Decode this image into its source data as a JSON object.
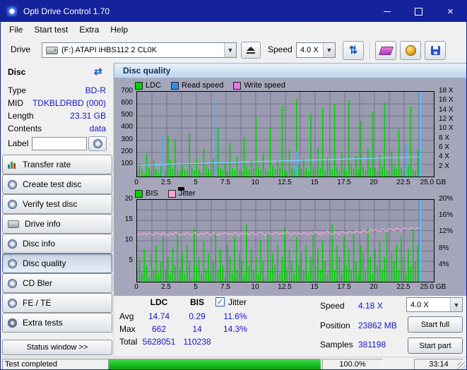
{
  "window": {
    "title": "Opti Drive Control 1.70"
  },
  "menu": {
    "items": [
      "File",
      "Start test",
      "Extra",
      "Help"
    ]
  },
  "toolbar": {
    "drive_label": "Drive",
    "drive_value": "(F:)  ATAPI iHBS112  2 CL0K",
    "speed_label": "Speed",
    "speed_value": "4.0 X"
  },
  "sidebar": {
    "disc_header": "Disc",
    "info": [
      {
        "label": "Type",
        "value": "BD-R"
      },
      {
        "label": "MID",
        "value": "TDKBLDRBD (000)"
      },
      {
        "label": "Length",
        "value": "23.31 GB"
      },
      {
        "label": "Contents",
        "value": "data"
      }
    ],
    "label_label": "Label",
    "label_value": "",
    "buttons": [
      "Transfer rate",
      "Create test disc",
      "Verify test disc",
      "Drive info",
      "Disc info",
      "Disc quality",
      "CD Bler",
      "FE / TE",
      "Extra tests"
    ],
    "active_button": "Disc quality",
    "status_window": "Status window >>"
  },
  "panel": {
    "title": "Disc quality"
  },
  "stats": {
    "headers": {
      "ldc": "LDC",
      "bis": "BIS"
    },
    "jitter_checkbox_label": "Jitter",
    "jitter_checked": true,
    "rows": [
      {
        "label": "Avg",
        "ldc": "14.74",
        "bis": "0.29",
        "jitter": "11.6%"
      },
      {
        "label": "Max",
        "ldc": "662",
        "bis": "14",
        "jitter": "14.3%"
      },
      {
        "label": "Total",
        "ldc": "5628051",
        "bis": "110238",
        "jitter": ""
      }
    ],
    "right": [
      {
        "label": "Speed",
        "value": "4.18 X"
      },
      {
        "label": "Position",
        "value": "23862 MB"
      },
      {
        "label": "Samples",
        "value": "381198"
      }
    ],
    "speed_select": "4.0 X",
    "start_full": "Start full",
    "start_part": "Start part"
  },
  "statusbar": {
    "status": "Test completed",
    "percent": "100.0%",
    "time": "33:14"
  },
  "colors": {
    "titlebar": "#14229b",
    "ldc_bar": "#00d400",
    "read_speed": "#2f8fe8",
    "write_speed": "#e878e0",
    "bis_bar": "#00d400",
    "jitter_line": "#f8a8d0",
    "value_text": "#1414cc",
    "progress": "#00b400",
    "chart_bg": "#9a9ab1"
  },
  "chart_data": [
    {
      "type": "bar",
      "title": "Disc quality - LDC / Read speed",
      "x_max_gb": 25.0,
      "data_end_gb": 23.86,
      "position_marker_gb": 23.86,
      "axis_marker_gb": 3.5,
      "x_ticks": [
        "0",
        "2.5",
        "5",
        "7.5",
        "10",
        "12.5",
        "15",
        "17.5",
        "20",
        "22.5",
        "25.0 GB"
      ],
      "y_left_ticks": [
        "700",
        "600",
        "500",
        "400",
        "300",
        "200",
        "100"
      ],
      "y_left_max": 700,
      "y_right_ticks": [
        "18 X",
        "16 X",
        "14 X",
        "12 X",
        "10 X",
        "8 X",
        "6 X",
        "4 X",
        "2 X"
      ],
      "y_right_max": 18,
      "series": [
        {
          "name": "LDC",
          "type": "bar",
          "color": "#00d400",
          "values": [
            38,
            110,
            55,
            25,
            185,
            70,
            45,
            130,
            60,
            30,
            85,
            240,
            50,
            340,
            140,
            65,
            310,
            55,
            40,
            100,
            60,
            45,
            360,
            80,
            50,
            160,
            55,
            35,
            230,
            90,
            65,
            40,
            150,
            50,
            400,
            75,
            55,
            120,
            45,
            280,
            70,
            50,
            170,
            60,
            40,
            330,
            85,
            55,
            130,
            65,
            490,
            80,
            50,
            190,
            70,
            45,
            410,
            90,
            60,
            140,
            75,
            580,
            55,
            40,
            220,
            80,
            50,
            640,
            95,
            65,
            150,
            70,
            45,
            520,
            85,
            55,
            240,
            75,
            570,
            50,
            160,
            90,
            60,
            600,
            80,
            50,
            200,
            70,
            45,
            630,
            95,
            65,
            170,
            55,
            460,
            85,
            50,
            230,
            75,
            540,
            70,
            45,
            180,
            80,
            610,
            55,
            40,
            210,
            90,
            65,
            390,
            75,
            50,
            250,
            85,
            580,
            60,
            45,
            220,
            80
          ]
        },
        {
          "name": "Read speed",
          "type": "line",
          "color": "#2f8fe8",
          "speed_start": 2.42,
          "speed_end": 4.18
        },
        {
          "name": "Write speed",
          "type": "line",
          "color": "#e878e0",
          "values": []
        }
      ],
      "read_spikes": [
        {
          "i": 11,
          "v": 340
        },
        {
          "i": 33,
          "v": 630
        },
        {
          "i": 67,
          "v": 210
        },
        {
          "i": 113,
          "v": 260
        }
      ]
    },
    {
      "type": "bar",
      "title": "Disc quality - BIS / Jitter",
      "x_max_gb": 25.0,
      "data_end_gb": 23.86,
      "position_marker_gb": 23.86,
      "x_ticks": [
        "0",
        "2.5",
        "5",
        "7.5",
        "10",
        "12.5",
        "15",
        "17.5",
        "20",
        "22.5",
        "25.0 GB"
      ],
      "y_left_ticks": [
        "20",
        "15",
        "10",
        "5"
      ],
      "y_left_max": 20,
      "y_right_ticks": [
        "20%",
        "16%",
        "12%",
        "8%",
        "4%"
      ],
      "y_right_max": 20,
      "series": [
        {
          "name": "BIS",
          "type": "bar",
          "color": "#00d400",
          "values": [
            3,
            6,
            2,
            8,
            4,
            1,
            7,
            3,
            9,
            2,
            5,
            11,
            3,
            6,
            2,
            8,
            4,
            12,
            3,
            7,
            2,
            9,
            5,
            1,
            13,
            4,
            6,
            2,
            10,
            3,
            7,
            2,
            5,
            12,
            3,
            8,
            4,
            1,
            9,
            6,
            2,
            11,
            3,
            7,
            5,
            2,
            14,
            4,
            8,
            3,
            6,
            2,
            10,
            5,
            1,
            12,
            3,
            7,
            4,
            9,
            2,
            6,
            13,
            3,
            8,
            5,
            2,
            11,
            4,
            7,
            3,
            9,
            2,
            6,
            12,
            4,
            8,
            3,
            10,
            5,
            2,
            7,
            14,
            3,
            9,
            6,
            2,
            11,
            4,
            8,
            3,
            12,
            5,
            2,
            9,
            7,
            3,
            13,
            6,
            2,
            8,
            4,
            10,
            3,
            6,
            12,
            2,
            7,
            5,
            9,
            3,
            11,
            6,
            2,
            8,
            4,
            13,
            5,
            9,
            3
          ]
        },
        {
          "name": "Jitter",
          "type": "line",
          "color": "#f8a8d0",
          "values": [
            11.2,
            11.8,
            11.5,
            12.0,
            11.4,
            11.9,
            11.6,
            11.3,
            12.1,
            11.7,
            11.4,
            12.0,
            11.6,
            11.2,
            11.9,
            11.5,
            12.2,
            11.7,
            11.3,
            11.8,
            11.5,
            12.1,
            11.6,
            11.4,
            12.0,
            11.7,
            11.3,
            11.9,
            11.5,
            12.2,
            11.6,
            11.4,
            12.0,
            11.8,
            11.3,
            11.9,
            11.6,
            12.1,
            11.5,
            11.8,
            11.4,
            12.2,
            11.7,
            11.3,
            12.0,
            11.6,
            11.9,
            11.5,
            12.1,
            11.7,
            11.4,
            11.9,
            12.2,
            11.6,
            11.3,
            12.0,
            11.7,
            11.5,
            12.1,
            11.8,
            11.5,
            12.0,
            11.6,
            12.3,
            11.8,
            11.4,
            12.1,
            11.7,
            11.9,
            11.5,
            12.2,
            11.8,
            11.4,
            12.0,
            11.6,
            12.3,
            11.9,
            11.5,
            12.1,
            11.7,
            12.4,
            11.8,
            11.5,
            12.2,
            11.9,
            11.6,
            12.3,
            12.0,
            11.7,
            12.4,
            12.1,
            11.8,
            12.5,
            12.2,
            11.9,
            12.6,
            12.3,
            12.0,
            12.7,
            12.4,
            12.8,
            12.5,
            12.2,
            12.9,
            12.6,
            12.3,
            13.0,
            12.7,
            12.4,
            13.1,
            12.8,
            12.5,
            13.2,
            12.9,
            12.6,
            13.3,
            13.0,
            12.8,
            13.2,
            13.1
          ]
        }
      ]
    }
  ]
}
